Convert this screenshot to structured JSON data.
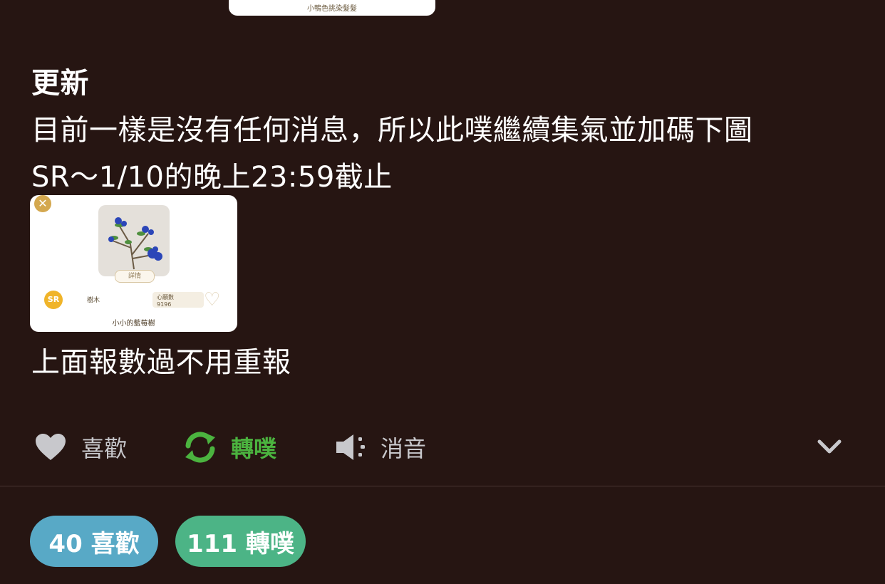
{
  "previous_card": {
    "caption": "小鴨色挑染髮髮"
  },
  "post": {
    "heading": "更新",
    "line1": "目前一樣是沒有任何消息，所以此噗繼續集氣並加碼下圖",
    "line2": "SR～1/10的晚上23:59截止",
    "after_text": "上面報數過不用重報"
  },
  "card": {
    "rarity": "SR",
    "detail_label": "詳情",
    "tag": "樹木",
    "price_label": "心願數",
    "price_value": "9196",
    "caption": "小小的藍莓樹"
  },
  "actions": {
    "like_label": "喜歡",
    "replurk_label": "轉噗",
    "mute_label": "消音"
  },
  "stats": {
    "likes": "40 喜歡",
    "replurks": "111 轉噗"
  },
  "colors": {
    "background": "#261512",
    "replurk_active": "#4bb33f",
    "likes_pill": "#58a9c6",
    "replurks_pill": "#4cb486"
  },
  "icons": [
    "heart-icon",
    "replurk-icon",
    "mute-icon",
    "chevron-down-icon",
    "close-icon"
  ]
}
